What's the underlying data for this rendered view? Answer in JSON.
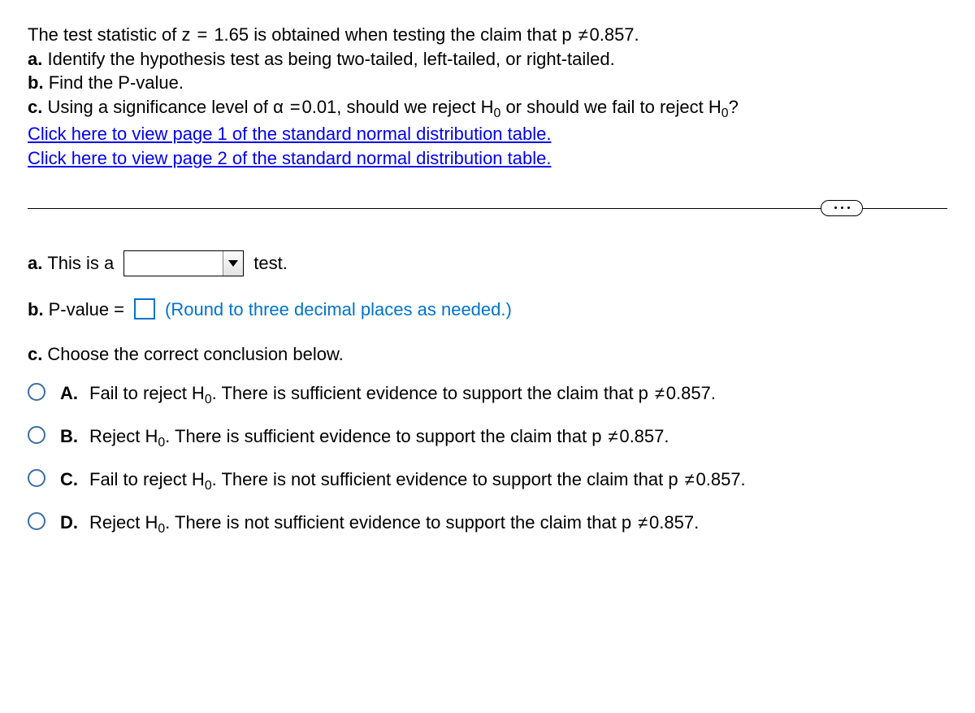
{
  "prompt": {
    "intro_pre": "The test statistic of z",
    "intro_eq": "=",
    "intro_z": "1.65 is obtained when testing the claim that p",
    "intro_ne": "≠",
    "intro_p": "0.857.",
    "a": "Identify the hypothesis test as being two-tailed, left-tailed, or right-tailed.",
    "b": "Find the P-value.",
    "c_pre": "Using a significance level of α",
    "c_eq": "=",
    "c_alpha": "0.01, should we reject H",
    "c_mid": " or should we fail to reject H",
    "c_end": "?",
    "link1": "Click here to view page 1 of the standard normal distribution table.",
    "link2": "Click here to view page 2 of the standard normal distribution table."
  },
  "answers": {
    "a_pre": "This is a",
    "a_post": "test.",
    "b_pre": "P-value",
    "b_eq": "=",
    "b_hint": "(Round to three decimal places as needed.)",
    "c_prompt": "Choose the correct conclusion below."
  },
  "labels": {
    "a": "a.",
    "b": "b.",
    "c": "c.",
    "sub0": "0"
  },
  "options": {
    "A": {
      "letter": "A.",
      "pre": "Fail to reject H",
      "post": ". There is sufficient evidence to support the claim that p",
      "ne": "≠",
      "val": "0.857."
    },
    "B": {
      "letter": "B.",
      "pre": "Reject H",
      "post": ". There is sufficient evidence to support the claim that p",
      "ne": "≠",
      "val": "0.857."
    },
    "C": {
      "letter": "C.",
      "pre": "Fail to reject H",
      "post": ". There is not sufficient evidence to support the claim that p",
      "ne": "≠",
      "val": "0.857."
    },
    "D": {
      "letter": "D.",
      "pre": "Reject H",
      "post": ". There is not sufficient evidence to support the claim that p",
      "ne": "≠",
      "val": "0.857."
    }
  }
}
